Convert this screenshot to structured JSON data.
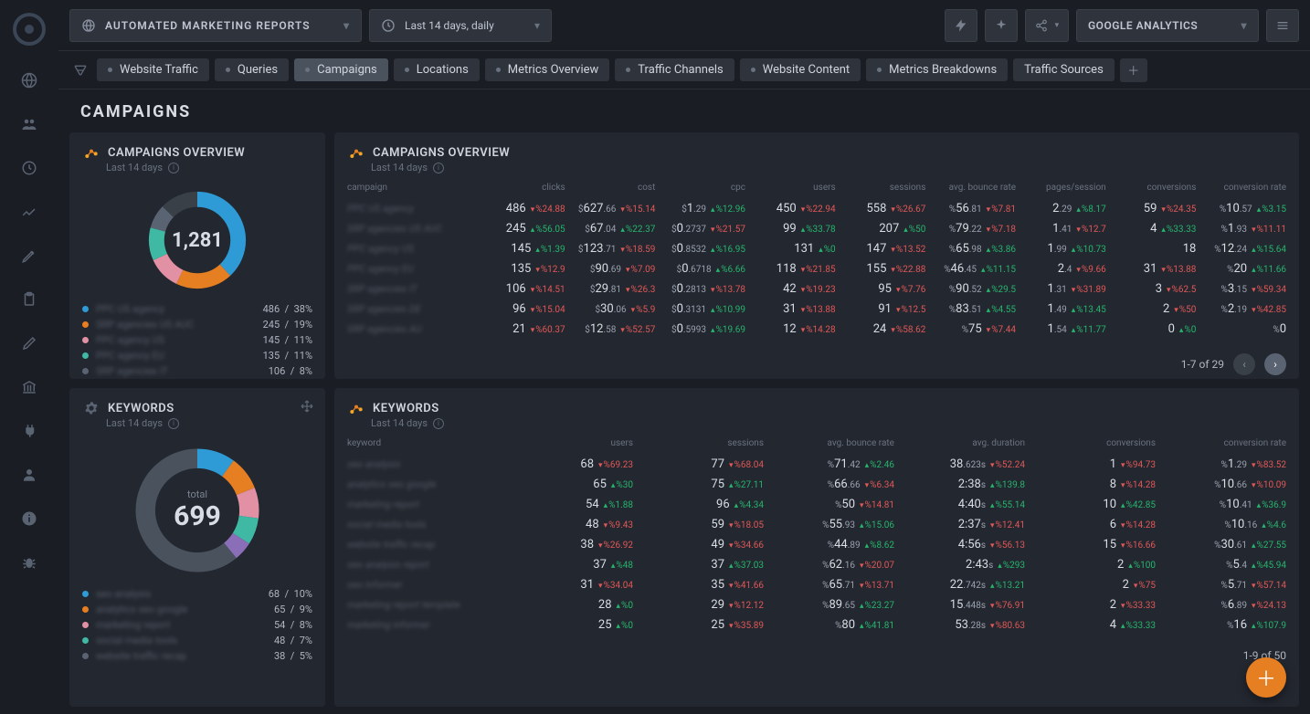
{
  "header": {
    "report_name": "AUTOMATED MARKETING REPORTS",
    "date_range": "Last 14 days, daily",
    "source": "GOOGLE ANALYTICS"
  },
  "tabs": [
    "Website Traffic",
    "Queries",
    "Campaigns",
    "Locations",
    "Metrics Overview",
    "Traffic Channels",
    "Website Content",
    "Metrics Breakdowns",
    "Traffic Sources"
  ],
  "active_tab": "Campaigns",
  "page_title": "CAMPAIGNS",
  "cards": {
    "campaigns_summary": {
      "title": "CAMPAIGNS OVERVIEW",
      "subtitle": "Last 14 days",
      "center": "1,281",
      "legend": [
        {
          "color": "#2e9bd6",
          "label": "PPC US agency",
          "val": "486",
          "pct": "38%"
        },
        {
          "color": "#e67e22",
          "label": "SRP agencies US AUC",
          "val": "245",
          "pct": "19%"
        },
        {
          "color": "#e291a4",
          "label": "PPC agency US",
          "val": "145",
          "pct": "11%"
        },
        {
          "color": "#3fb8a4",
          "label": "PPC agency EU",
          "val": "135",
          "pct": "11%"
        },
        {
          "color": "#5a6372",
          "label": "SRP agencies IT",
          "val": "106",
          "pct": "8%"
        }
      ]
    },
    "campaigns_table": {
      "title": "CAMPAIGNS OVERVIEW",
      "subtitle": "Last 14 days",
      "columns": [
        "campaign",
        "clicks",
        "cost",
        "cpc",
        "users",
        "sessions",
        "avg. bounce rate",
        "pages/session",
        "conversions",
        "conversion rate"
      ],
      "rows": [
        {
          "name": "PPC US agency",
          "cells": [
            {
              "v": "486",
              "d": "-24.88"
            },
            {
              "pre": "$",
              "v": "627",
              "dec": ".66",
              "d": "-15.14"
            },
            {
              "pre": "$",
              "v": "1",
              "dec": ".29",
              "d": "+12.96"
            },
            {
              "v": "450",
              "d": "-22.94"
            },
            {
              "v": "558",
              "d": "-26.67"
            },
            {
              "pre": "%",
              "v": "56",
              "dec": ".81",
              "d": "-7.81"
            },
            {
              "v": "2",
              "dec": ".29",
              "d": "+8.17"
            },
            {
              "v": "59",
              "d": "-24.35"
            },
            {
              "pre": "%",
              "v": "10",
              "dec": ".57",
              "d": "+3.15"
            }
          ]
        },
        {
          "name": "SRP agencies US AUC",
          "cells": [
            {
              "v": "245",
              "d": "+56.05"
            },
            {
              "pre": "$",
              "v": "67",
              "dec": ".04",
              "d": "+22.37"
            },
            {
              "pre": "$",
              "v": "0",
              "dec": ".2737",
              "d": "-21.57"
            },
            {
              "v": "99",
              "d": "+33.78"
            },
            {
              "v": "207",
              "d": "+50"
            },
            {
              "pre": "%",
              "v": "79",
              "dec": ".22",
              "d": "-7.18"
            },
            {
              "v": "1",
              "dec": ".41",
              "d": "-12.7"
            },
            {
              "v": "4",
              "d": "+33.33"
            },
            {
              "pre": "%",
              "v": "1",
              "dec": ".93",
              "d": "-11.11"
            }
          ]
        },
        {
          "name": "PPC agency US",
          "cells": [
            {
              "v": "145",
              "d": "+1.39"
            },
            {
              "pre": "$",
              "v": "123",
              "dec": ".71",
              "d": "-18.59"
            },
            {
              "pre": "$",
              "v": "0",
              "dec": ".8532",
              "d": "+16.95"
            },
            {
              "v": "131",
              "d": "+0"
            },
            {
              "v": "147",
              "d": "-13.52"
            },
            {
              "pre": "%",
              "v": "65",
              "dec": ".98",
              "d": "+3.86"
            },
            {
              "v": "1",
              "dec": ".99",
              "d": "+10.73"
            },
            {
              "v": "18"
            },
            {
              "pre": "%",
              "v": "12",
              "dec": ".24",
              "d": "+15.64"
            }
          ]
        },
        {
          "name": "PPC agency EU",
          "cells": [
            {
              "v": "135",
              "d": "-12.9"
            },
            {
              "pre": "$",
              "v": "90",
              "dec": ".69",
              "d": "-7.09"
            },
            {
              "pre": "$",
              "v": "0",
              "dec": ".6718",
              "d": "+6.66"
            },
            {
              "v": "118",
              "d": "-21.85"
            },
            {
              "v": "155",
              "d": "-22.88"
            },
            {
              "pre": "%",
              "v": "46",
              "dec": ".45",
              "d": "+11.15"
            },
            {
              "v": "2",
              "dec": ".4",
              "d": "-9.66"
            },
            {
              "v": "31",
              "d": "-13.88"
            },
            {
              "pre": "%",
              "v": "20",
              "d": "+11.66"
            }
          ]
        },
        {
          "name": "SRP agencies IT",
          "cells": [
            {
              "v": "106",
              "d": "-14.51"
            },
            {
              "pre": "$",
              "v": "29",
              "dec": ".81",
              "d": "-26.3"
            },
            {
              "pre": "$",
              "v": "0",
              "dec": ".2813",
              "d": "-13.78"
            },
            {
              "v": "42",
              "d": "-19.23"
            },
            {
              "v": "95",
              "d": "-7.76"
            },
            {
              "pre": "%",
              "v": "90",
              "dec": ".52",
              "d": "+29.5"
            },
            {
              "v": "1",
              "dec": ".31",
              "d": "-31.89"
            },
            {
              "v": "3",
              "d": "-62.5"
            },
            {
              "pre": "%",
              "v": "3",
              "dec": ".15",
              "d": "-59.34"
            }
          ]
        },
        {
          "name": "SRP agencies DE",
          "cells": [
            {
              "v": "96",
              "d": "-15.04"
            },
            {
              "pre": "$",
              "v": "30",
              "dec": ".06",
              "d": "-5.9"
            },
            {
              "pre": "$",
              "v": "0",
              "dec": ".3131",
              "d": "+10.99"
            },
            {
              "v": "31",
              "d": "-13.88"
            },
            {
              "v": "91",
              "d": "-12.5"
            },
            {
              "pre": "%",
              "v": "83",
              "dec": ".51",
              "d": "+4.55"
            },
            {
              "v": "1",
              "dec": ".49",
              "d": "+13.45"
            },
            {
              "v": "2",
              "d": "-50"
            },
            {
              "pre": "%",
              "v": "2",
              "dec": ".19",
              "d": "-42.85"
            }
          ]
        },
        {
          "name": "SRP agencies AU",
          "cells": [
            {
              "v": "21",
              "d": "-60.37"
            },
            {
              "pre": "$",
              "v": "12",
              "dec": ".58",
              "d": "-52.57"
            },
            {
              "pre": "$",
              "v": "0",
              "dec": ".5993",
              "d": "+19.69"
            },
            {
              "v": "12",
              "d": "-14.28"
            },
            {
              "v": "24",
              "d": "-58.62"
            },
            {
              "pre": "%",
              "v": "75",
              "d": "-7.44"
            },
            {
              "v": "1",
              "dec": ".54",
              "d": "+11.77"
            },
            {
              "v": "0",
              "d": "+0"
            },
            {
              "pre": "%",
              "v": "0"
            }
          ]
        }
      ],
      "pager": "1-7 of 29"
    },
    "keywords_summary": {
      "title": "KEYWORDS",
      "subtitle": "Last 14 days",
      "center_label": "total",
      "center": "699",
      "legend": [
        {
          "color": "#2e9bd6",
          "label": "seo analysis",
          "val": "68",
          "pct": "10%"
        },
        {
          "color": "#e67e22",
          "label": "analytics seo google",
          "val": "65",
          "pct": "9%"
        },
        {
          "color": "#e291a4",
          "label": "marketing report",
          "val": "54",
          "pct": "8%"
        },
        {
          "color": "#3fb8a4",
          "label": "social media tools",
          "val": "48",
          "pct": "7%"
        },
        {
          "color": "#5a6372",
          "label": "website traffic recap",
          "val": "38",
          "pct": "5%"
        }
      ]
    },
    "keywords_table": {
      "title": "KEYWORDS",
      "subtitle": "Last 14 days",
      "columns": [
        "keyword",
        "users",
        "sessions",
        "avg. bounce rate",
        "avg. duration",
        "conversions",
        "conversion rate"
      ],
      "rows": [
        {
          "name": "seo analysis",
          "cells": [
            {
              "v": "68",
              "d": "-69.23"
            },
            {
              "v": "77",
              "d": "-68.04"
            },
            {
              "pre": "%",
              "v": "71",
              "dec": ".42",
              "d": "+2.46"
            },
            {
              "v": "38",
              "dec": ".623s",
              "d": "-52.24"
            },
            {
              "v": "1",
              "d": "-94.73"
            },
            {
              "pre": "%",
              "v": "1",
              "dec": ".29",
              "d": "-83.52"
            }
          ]
        },
        {
          "name": "analytics seo google",
          "cells": [
            {
              "v": "65",
              "d": "+30"
            },
            {
              "v": "75",
              "d": "+27.11"
            },
            {
              "pre": "%",
              "v": "66",
              "dec": ".66",
              "d": "-6.34"
            },
            {
              "v": "2:38",
              "dec": "s",
              "d": "+139.8"
            },
            {
              "v": "8",
              "d": "-14.28"
            },
            {
              "pre": "%",
              "v": "10",
              "dec": ".66",
              "d": "-10.09"
            }
          ]
        },
        {
          "name": "marketing report",
          "cells": [
            {
              "v": "54",
              "d": "+1.88"
            },
            {
              "v": "96",
              "d": "+4.34"
            },
            {
              "pre": "%",
              "v": "50",
              "d": "-14.81"
            },
            {
              "v": "4:40",
              "dec": "s",
              "d": "+55.14"
            },
            {
              "v": "10",
              "d": "+42.85"
            },
            {
              "pre": "%",
              "v": "10",
              "dec": ".41",
              "d": "+36.9"
            }
          ]
        },
        {
          "name": "social media tools",
          "cells": [
            {
              "v": "48",
              "d": "-9.43"
            },
            {
              "v": "59",
              "d": "-18.05"
            },
            {
              "pre": "%",
              "v": "55",
              "dec": ".93",
              "d": "+15.06"
            },
            {
              "v": "2:37",
              "dec": "s",
              "d": "-12.41"
            },
            {
              "v": "6",
              "d": "-14.28"
            },
            {
              "pre": "%",
              "v": "10",
              "dec": ".16",
              "d": "+4.6"
            }
          ]
        },
        {
          "name": "website traffic recap",
          "cells": [
            {
              "v": "38",
              "d": "-26.92"
            },
            {
              "v": "49",
              "d": "-34.66"
            },
            {
              "pre": "%",
              "v": "44",
              "dec": ".89",
              "d": "+8.62"
            },
            {
              "v": "4:56",
              "dec": "s",
              "d": "-56.13"
            },
            {
              "v": "15",
              "d": "-16.66"
            },
            {
              "pre": "%",
              "v": "30",
              "dec": ".61",
              "d": "+27.55"
            }
          ]
        },
        {
          "name": "seo analysis report",
          "cells": [
            {
              "v": "37",
              "d": "+48"
            },
            {
              "v": "37",
              "d": "+37.03"
            },
            {
              "pre": "%",
              "v": "62",
              "dec": ".16",
              "d": "-20.07"
            },
            {
              "v": "2:43",
              "dec": "s",
              "d": "+293"
            },
            {
              "v": "2",
              "d": "+100"
            },
            {
              "pre": "%",
              "v": "5",
              "dec": ".4",
              "d": "+45.94"
            }
          ]
        },
        {
          "name": "seo informer",
          "cells": [
            {
              "v": "31",
              "d": "-34.04"
            },
            {
              "v": "35",
              "d": "-41.66"
            },
            {
              "pre": "%",
              "v": "65",
              "dec": ".71",
              "d": "-13.71"
            },
            {
              "v": "22",
              "dec": ".742s",
              "d": "+13.21"
            },
            {
              "v": "2",
              "d": "-75"
            },
            {
              "pre": "%",
              "v": "5",
              "dec": ".71",
              "d": "-57.14"
            }
          ]
        },
        {
          "name": "marketing report template",
          "cells": [
            {
              "v": "28",
              "d": "+0"
            },
            {
              "v": "29",
              "d": "-12.12"
            },
            {
              "pre": "%",
              "v": "89",
              "dec": ".65",
              "d": "+23.27"
            },
            {
              "v": "15",
              "dec": ".448s",
              "d": "-76.91"
            },
            {
              "v": "2",
              "d": "-33.33"
            },
            {
              "pre": "%",
              "v": "6",
              "dec": ".89",
              "d": "-24.13"
            }
          ]
        },
        {
          "name": "marketing informer",
          "cells": [
            {
              "v": "25",
              "d": "+0"
            },
            {
              "v": "25",
              "d": "-35.89"
            },
            {
              "pre": "%",
              "v": "80",
              "d": "+41.81"
            },
            {
              "v": "53",
              "dec": ".28s",
              "d": "-80.63"
            },
            {
              "v": "4",
              "d": "+33.33"
            },
            {
              "pre": "%",
              "v": "16",
              "d": "+107.9"
            }
          ]
        }
      ],
      "pager": "1-9 of 50"
    }
  }
}
